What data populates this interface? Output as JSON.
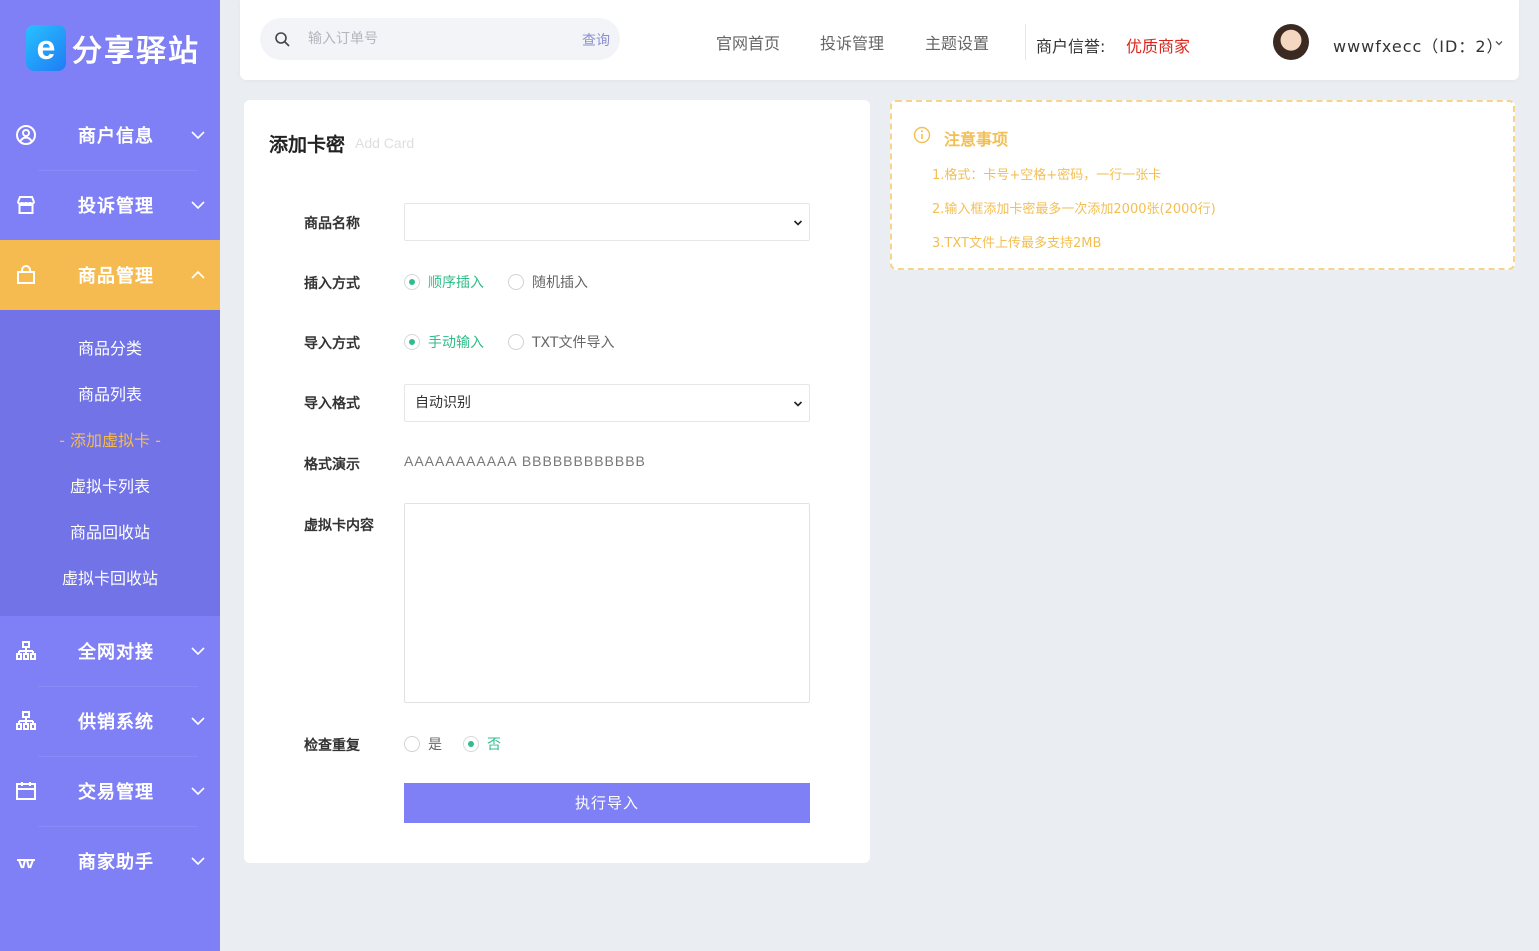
{
  "sidebar": {
    "logo_mark": "e",
    "logo_text": "分享驿站",
    "items": [
      {
        "label": "商户信息",
        "icon": "user-circle-icon"
      },
      {
        "label": "投诉管理",
        "icon": "shop-icon"
      },
      {
        "label": "商品管理",
        "icon": "bag-icon",
        "active": true
      },
      {
        "label": "全网对接",
        "icon": "network-icon"
      },
      {
        "label": "供销系统",
        "icon": "network-icon"
      },
      {
        "label": "交易管理",
        "icon": "calendar-icon"
      },
      {
        "label": "商家助手",
        "icon": "helper-icon"
      }
    ],
    "sub_items": [
      {
        "label": "商品分类"
      },
      {
        "label": "商品列表"
      },
      {
        "label": "- 添加虚拟卡 -",
        "active": true
      },
      {
        "label": "虚拟卡列表"
      },
      {
        "label": "商品回收站"
      },
      {
        "label": "虚拟卡回收站"
      }
    ]
  },
  "header": {
    "search_placeholder": "输入订单号",
    "search_button": "查询",
    "nav": [
      "官网首页",
      "投诉管理",
      "主题设置"
    ],
    "credit_label": "商户信誉:",
    "credit_value": "优质商家",
    "username": "wwwfxecc（ID：2）"
  },
  "card": {
    "title": "添加卡密",
    "subtitle": "Add Card",
    "fields": {
      "product_name": {
        "label": "商品名称",
        "value": ""
      },
      "insert_mode": {
        "label": "插入方式",
        "options": [
          "顺序插入",
          "随机插入"
        ],
        "selected": 0
      },
      "import_mode": {
        "label": "导入方式",
        "options": [
          "手动输入",
          "TXT文件导入"
        ],
        "selected": 0
      },
      "import_format": {
        "label": "导入格式",
        "value": "自动识别"
      },
      "format_demo": {
        "label": "格式演示",
        "value": "AAAAAAAAAAA BBBBBBBBBBBB"
      },
      "card_content": {
        "label": "虚拟卡内容",
        "value": ""
      },
      "check_duplicate": {
        "label": "检查重复",
        "options": [
          "是",
          "否"
        ],
        "selected": 1
      }
    },
    "submit_label": "执行导入"
  },
  "notice": {
    "title": "注意事项",
    "lines": [
      "1.格式：卡号+空格+密码，一行一张卡",
      "2.输入框添加卡密最多一次添加2000张(2000行)",
      "3.TXT文件上传最多支持2MB"
    ]
  },
  "colors": {
    "sidebar": "#7f80f6",
    "active": "#f6bb50",
    "radio_on": "#2fbd8a",
    "credit": "#d9271e",
    "notice": "#f3bf52"
  }
}
